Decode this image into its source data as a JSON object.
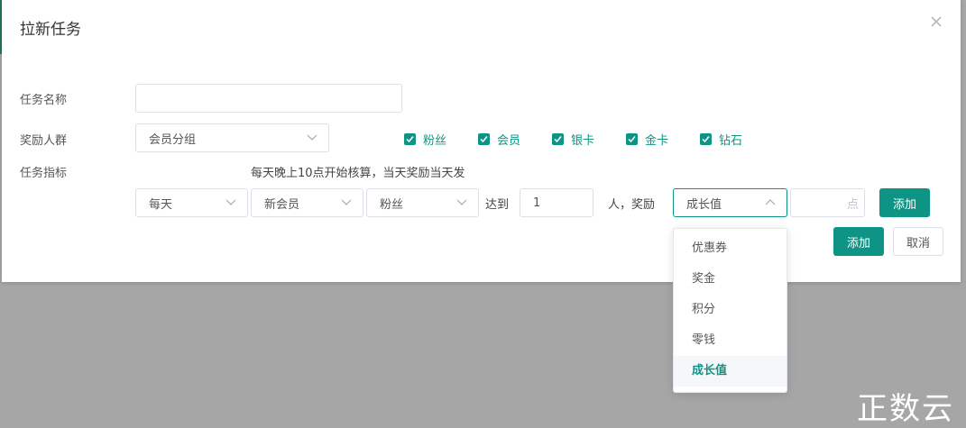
{
  "dialog": {
    "title": "拉新任务"
  },
  "form": {
    "task_name_label": "任务名称",
    "task_name_value": "",
    "reward_group_label": "奖励人群",
    "reward_group_select": "会员分组",
    "groups": [
      {
        "label": "粉丝",
        "checked": true
      },
      {
        "label": "会员",
        "checked": true
      },
      {
        "label": "银卡",
        "checked": true
      },
      {
        "label": "金卡",
        "checked": true
      },
      {
        "label": "钻石",
        "checked": true
      }
    ],
    "task_metric_label": "任务指标",
    "metric_note": "每天晚上10点开始核算，当天奖励当天发",
    "period_select": "每天",
    "member_type_select": "新会员",
    "audience_select": "粉丝",
    "reach_label": "达到",
    "reach_count": "1",
    "people_reward_label": "人，奖励",
    "reward_type_select": "成长值",
    "reward_amount_placeholder": "点",
    "reward_amount_value": "",
    "add_rule_button": "添加"
  },
  "footer": {
    "confirm_button": "添加",
    "cancel_button": "取消"
  },
  "dropdown": {
    "options": [
      "优惠券",
      "奖金",
      "积分",
      "零钱",
      "成长值"
    ],
    "selected": "成长值"
  },
  "watermark": "正数云",
  "colors": {
    "accent": "#0e9485",
    "overlay": "#a6a6a6",
    "border": "#dcdfe6"
  }
}
